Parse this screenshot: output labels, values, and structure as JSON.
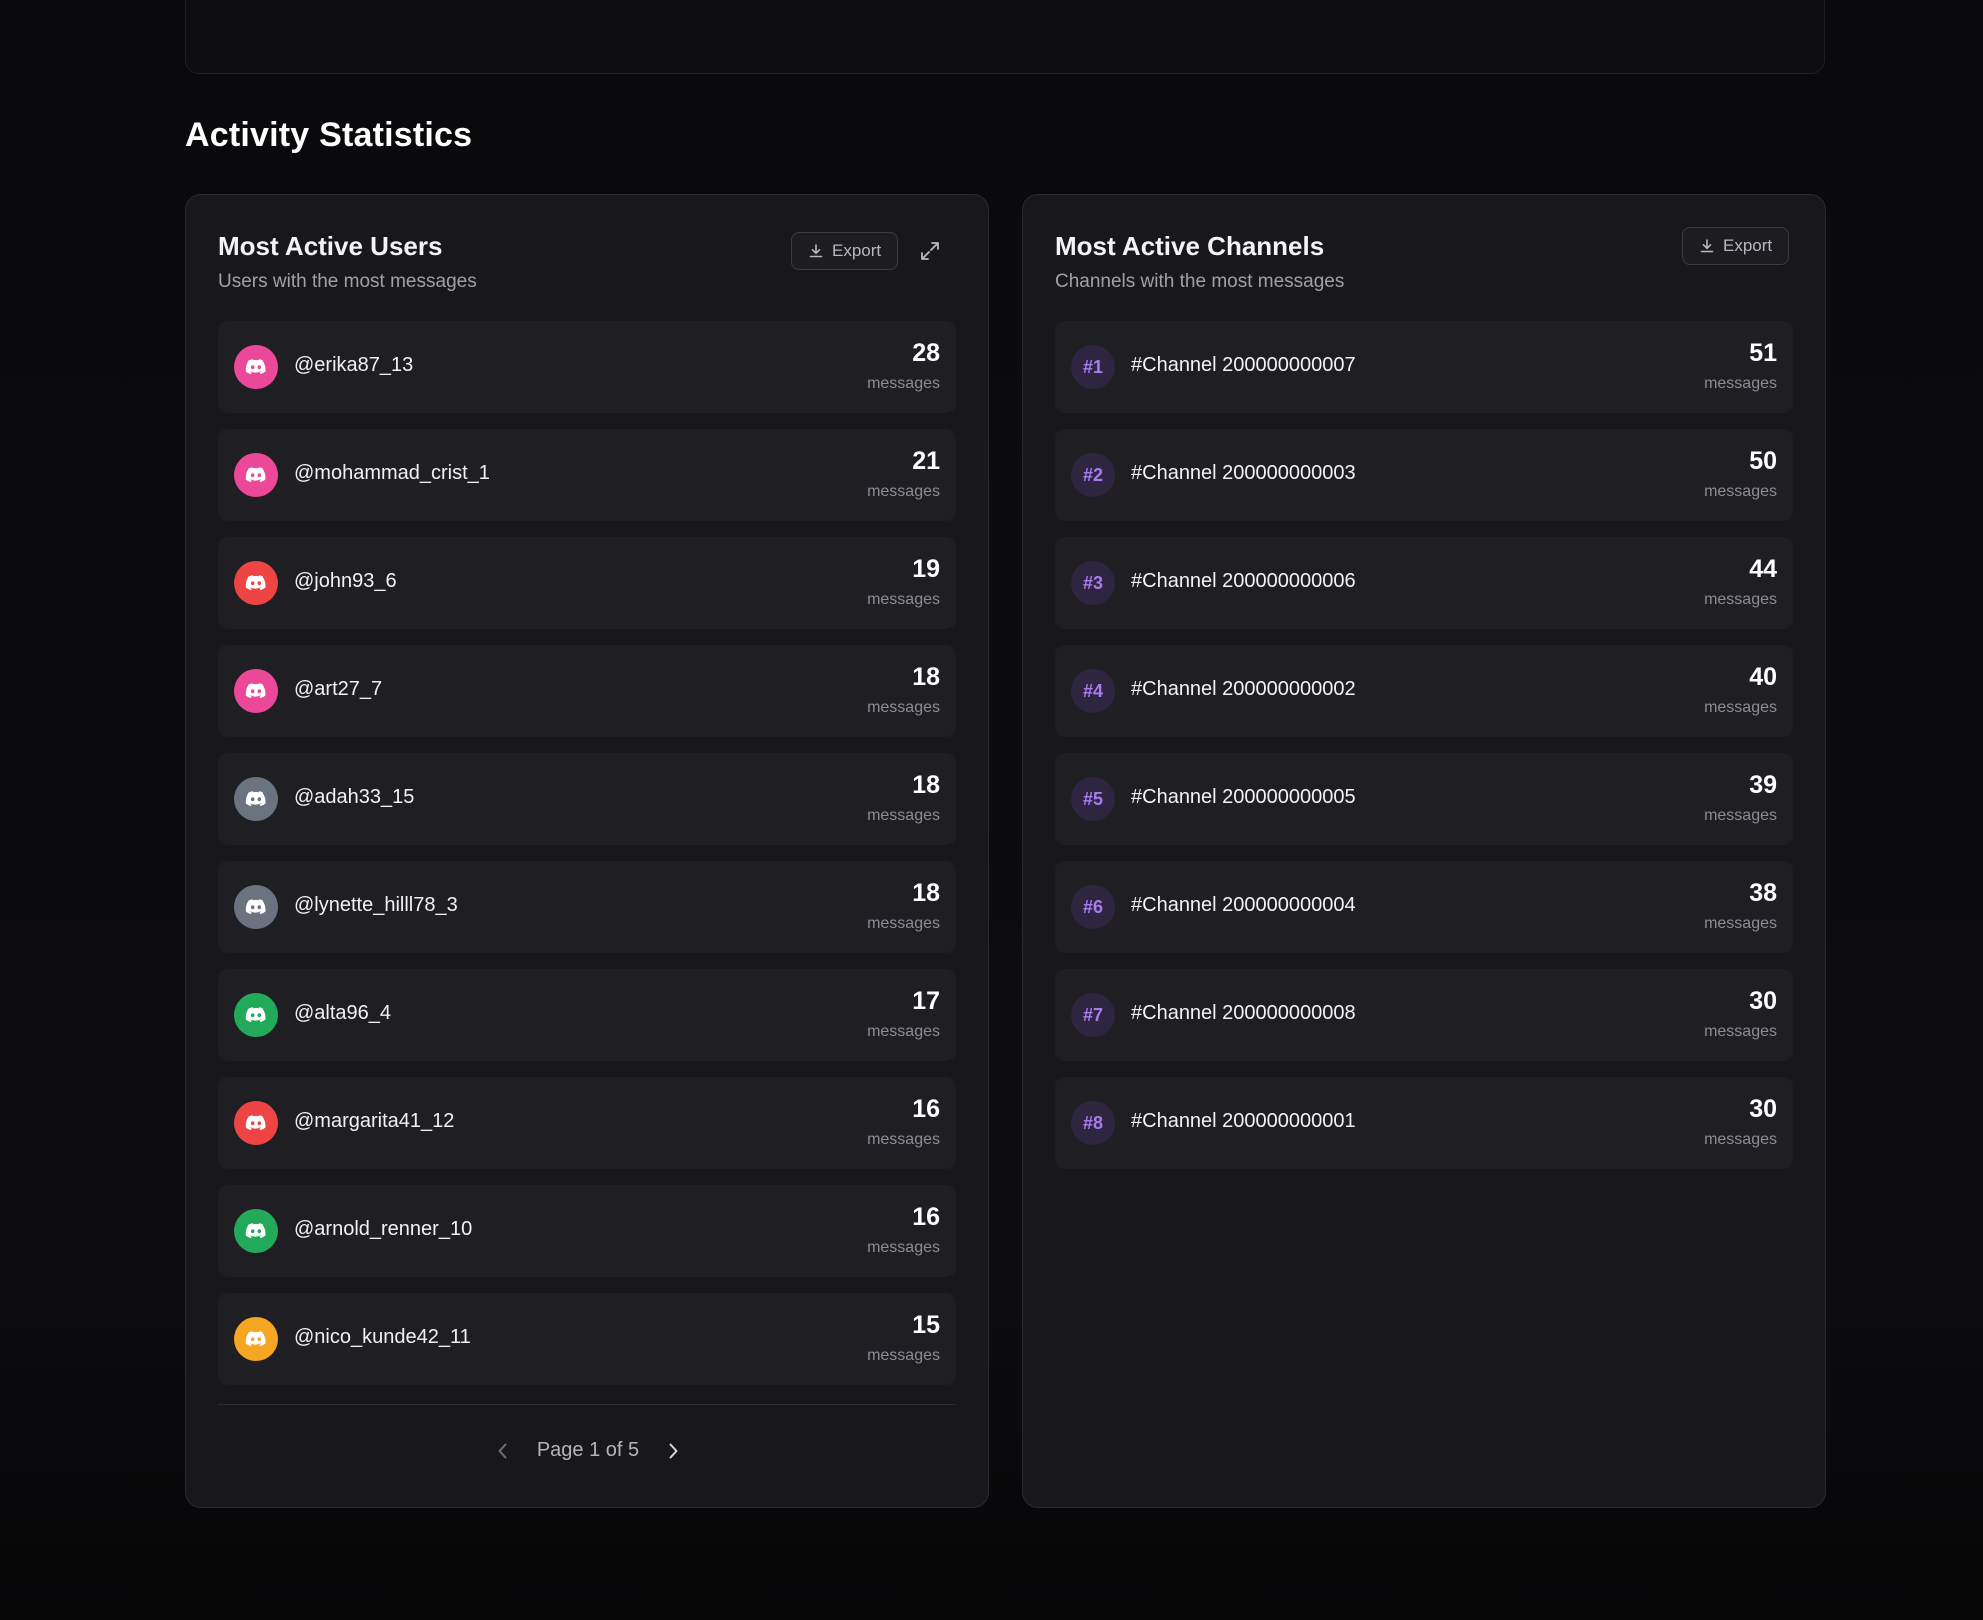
{
  "section_title": "Activity Statistics",
  "users_panel": {
    "title": "Most Active Users",
    "subtitle": "Users with the most messages",
    "export_label": "Export",
    "items": [
      {
        "name": "@erika87_13",
        "count": "28",
        "unit": "messages",
        "color": "#ec4899"
      },
      {
        "name": "@mohammad_crist_1",
        "count": "21",
        "unit": "messages",
        "color": "#ec4899"
      },
      {
        "name": "@john93_6",
        "count": "19",
        "unit": "messages",
        "color": "#ef4444"
      },
      {
        "name": "@art27_7",
        "count": "18",
        "unit": "messages",
        "color": "#ec4899"
      },
      {
        "name": "@adah33_15",
        "count": "18",
        "unit": "messages",
        "color": "#6b7280"
      },
      {
        "name": "@lynette_hilll78_3",
        "count": "18",
        "unit": "messages",
        "color": "#6b7280"
      },
      {
        "name": "@alta96_4",
        "count": "17",
        "unit": "messages",
        "color": "#22a95a"
      },
      {
        "name": "@margarita41_12",
        "count": "16",
        "unit": "messages",
        "color": "#ef4444"
      },
      {
        "name": "@arnold_renner_10",
        "count": "16",
        "unit": "messages",
        "color": "#22a95a"
      },
      {
        "name": "@nico_kunde42_11",
        "count": "15",
        "unit": "messages",
        "color": "#f5a623"
      }
    ],
    "pagination": "Page 1 of 5"
  },
  "channels_panel": {
    "title": "Most Active Channels",
    "subtitle": "Channels with the most messages",
    "export_label": "Export",
    "items": [
      {
        "rank": "#1",
        "name": "#Channel 200000000007",
        "count": "51",
        "unit": "messages"
      },
      {
        "rank": "#2",
        "name": "#Channel 200000000003",
        "count": "50",
        "unit": "messages"
      },
      {
        "rank": "#3",
        "name": "#Channel 200000000006",
        "count": "44",
        "unit": "messages"
      },
      {
        "rank": "#4",
        "name": "#Channel 200000000002",
        "count": "40",
        "unit": "messages"
      },
      {
        "rank": "#5",
        "name": "#Channel 200000000005",
        "count": "39",
        "unit": "messages"
      },
      {
        "rank": "#6",
        "name": "#Channel 200000000004",
        "count": "38",
        "unit": "messages"
      },
      {
        "rank": "#7",
        "name": "#Channel 200000000008",
        "count": "30",
        "unit": "messages"
      },
      {
        "rank": "#8",
        "name": "#Channel 200000000001",
        "count": "30",
        "unit": "messages"
      }
    ]
  },
  "icons": {
    "avatar": "discord-icon",
    "export": "download-icon",
    "expand": "expand-icon",
    "prev": "chevron-left-icon",
    "next": "chevron-right-icon"
  }
}
